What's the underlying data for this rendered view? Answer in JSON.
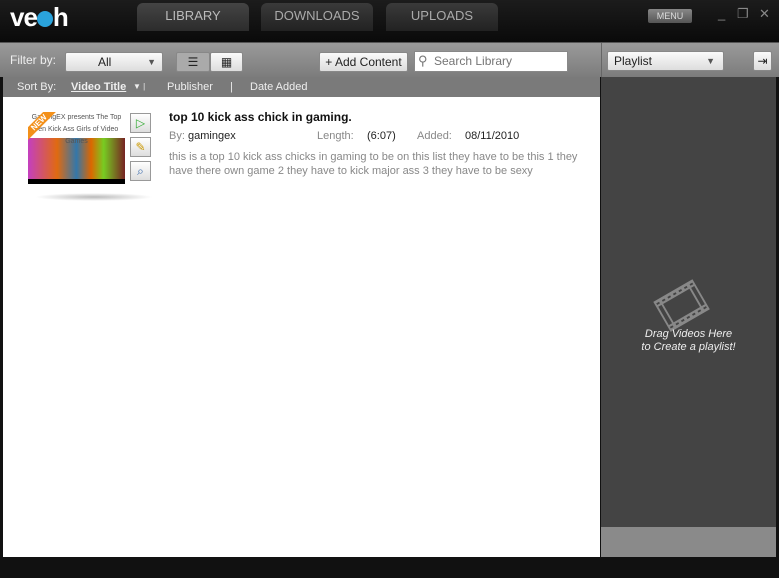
{
  "app": {
    "logo": "veoh"
  },
  "tabs": [
    {
      "label": "LIBRARY"
    },
    {
      "label": "DOWNLOADS"
    },
    {
      "label": "UPLOADS"
    }
  ],
  "window": {
    "menu": "MENU",
    "minimize": "_",
    "restore": "❐",
    "close": "✕"
  },
  "toolbar": {
    "filter_label": "Filter by:",
    "filter_value": "All",
    "add_content": "+ Add Content",
    "search_placeholder": "Search Library",
    "playlist_value": "Playlist"
  },
  "sort": {
    "label": "Sort By:",
    "options": [
      "Video Title",
      "Publisher",
      "Date Added"
    ],
    "active": "Video Title"
  },
  "videos": [
    {
      "badge": "NEW",
      "thumb_text": "GamingEX presents The Top Ten Kick Ass Girls of Video Games",
      "title": "top 10 kick ass chick in gaming.",
      "by_label": "By:",
      "by": "gamingex",
      "length_label": "Length:",
      "length": "(6:07)",
      "added_label": "Added:",
      "added": "08/11/2010",
      "description": "this is a top 10 kick ass chicks in gaming to be on this list they have to be this 1 they have there own game  2 they have to kick major ass 3 they have to be sexy"
    }
  ],
  "playlist": {
    "hint_line1": "Drag Videos Here",
    "hint_line2": "to Create a playlist!"
  }
}
